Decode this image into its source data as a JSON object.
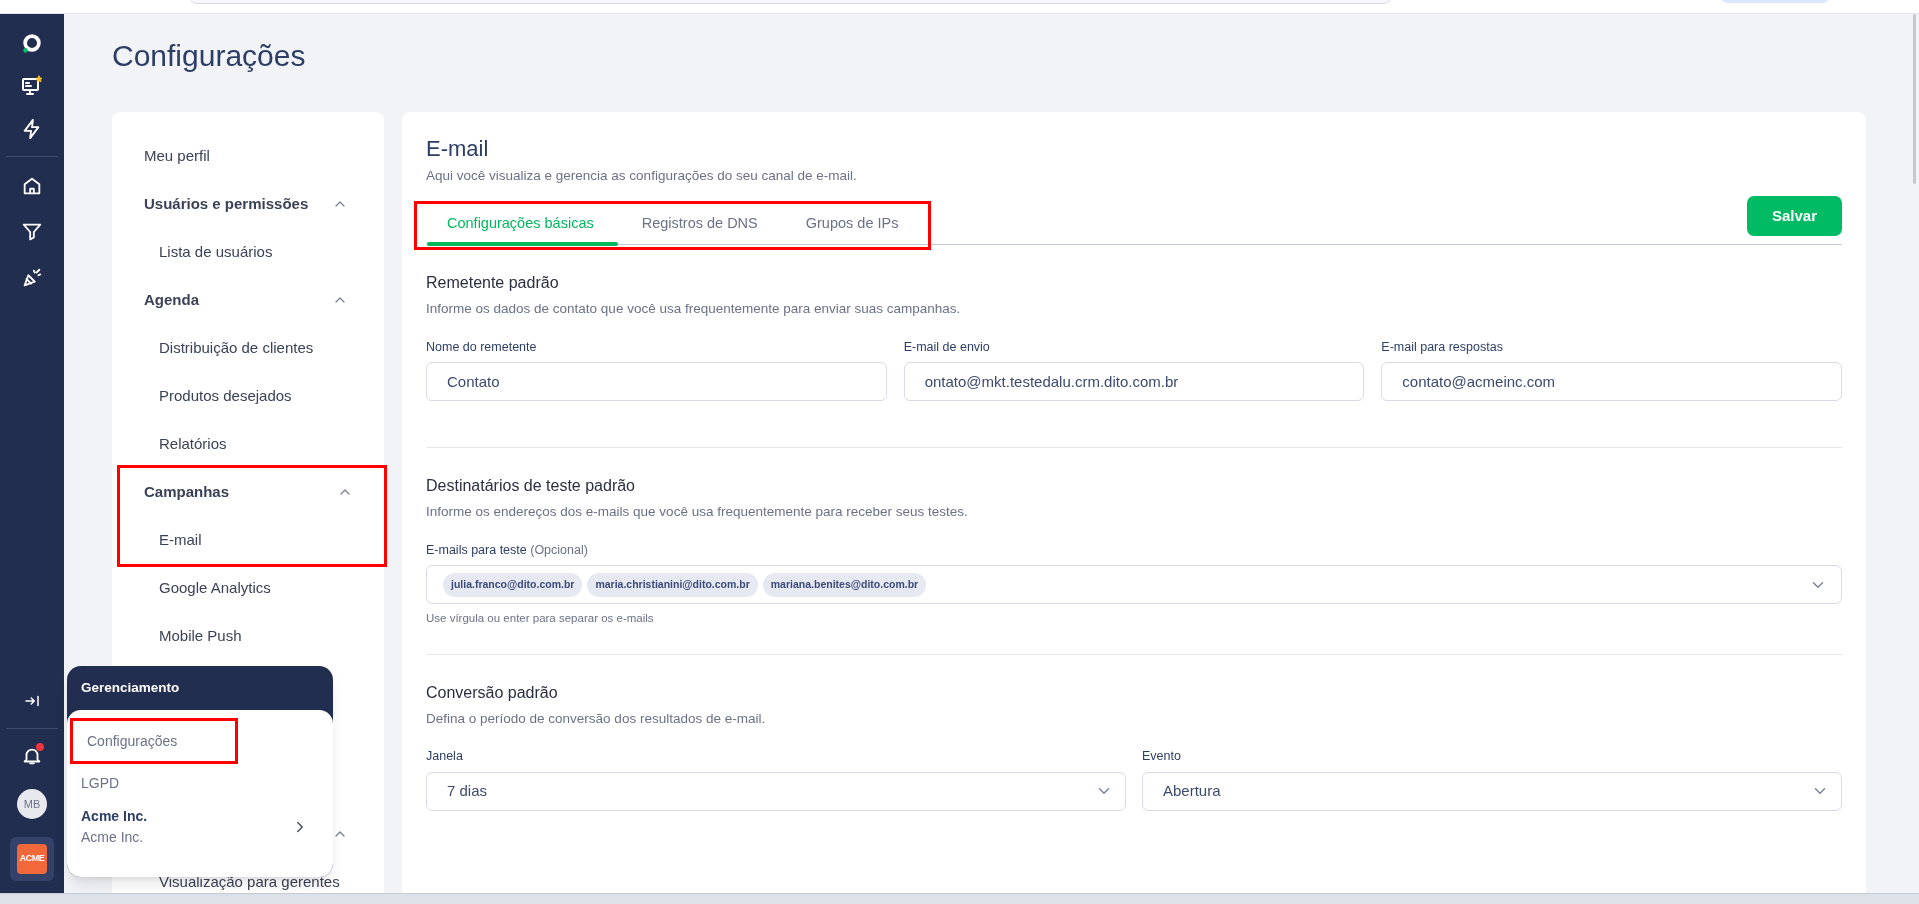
{
  "rail": {
    "has_notification": true,
    "avatar_initials": "MB",
    "logo_text": "ACME"
  },
  "page_title": "Configurações",
  "settings_menu": {
    "items": [
      {
        "kind": "link",
        "label": "Meu perfil"
      },
      {
        "kind": "group",
        "label": "Usuários e permissões",
        "expanded": true,
        "children": [
          {
            "label": "Lista de usuários"
          }
        ]
      },
      {
        "kind": "group",
        "label": "Agenda",
        "expanded": true,
        "children": [
          {
            "label": "Distribuição de clientes"
          },
          {
            "label": "Produtos desejados"
          },
          {
            "label": "Relatórios"
          }
        ]
      },
      {
        "kind": "group",
        "label": "Campanhas",
        "expanded": true,
        "highlighted": true,
        "children": [
          {
            "label": "E-mail"
          },
          {
            "label": "Google Analytics"
          },
          {
            "label": "Mobile Push"
          }
        ]
      },
      {
        "kind": "covered-group",
        "expanded": true,
        "children": [
          {
            "label": "Visualização para gerentes"
          }
        ]
      }
    ]
  },
  "email": {
    "title": "E-mail",
    "subtitle": "Aqui você visualiza e gerencia as configurações do seu canal de e-mail.",
    "tabs_highlighted": true,
    "tabs": [
      {
        "label": "Configurações básicas",
        "selected": true
      },
      {
        "label": "Registros de DNS",
        "selected": false
      },
      {
        "label": "Grupos de IPs",
        "selected": false
      }
    ],
    "save_button": "Salvar",
    "sections": [
      {
        "kind": "fields",
        "title": "Remetente padrão",
        "description": "Informe os dados de contato que você usa frequentemente para enviar suas campanhas.",
        "fields": [
          {
            "label": "Nome do remetente",
            "value": "Contato"
          },
          {
            "label": "E-mail de envio",
            "value": "ontato@mkt.testedalu.crm.dito.com.br"
          },
          {
            "label": "E-mail para respostas",
            "value": "contato@acmeinc.com"
          }
        ]
      },
      {
        "kind": "chips",
        "title": "Destinatários de teste padrão",
        "description": "Informe os endereços dos e-mails que você usa frequentemente para receber seus testes.",
        "label": "E-mails para teste",
        "note": "(Opcional)",
        "chips": [
          "julia.franco@dito.com.br",
          "maria.christianini@dito.com.br",
          "mariana.benites@dito.com.br"
        ],
        "hint": "Use vírgula ou enter para separar os e-mails"
      },
      {
        "kind": "selects",
        "title": "Conversão padrão",
        "description": "Defina o período de conversão dos resultados de e-mail.",
        "fields": [
          {
            "label": "Janela",
            "value": "7 dias"
          },
          {
            "label": "Evento",
            "value": "Abertura"
          }
        ]
      }
    ]
  },
  "popup": {
    "title": "Gerenciamento",
    "items": [
      {
        "label": "Configurações",
        "highlighted": true
      },
      {
        "label": "LGPD",
        "highlighted": false
      }
    ],
    "account": {
      "name": "Acme Inc.",
      "subtitle": "Acme Inc."
    }
  }
}
